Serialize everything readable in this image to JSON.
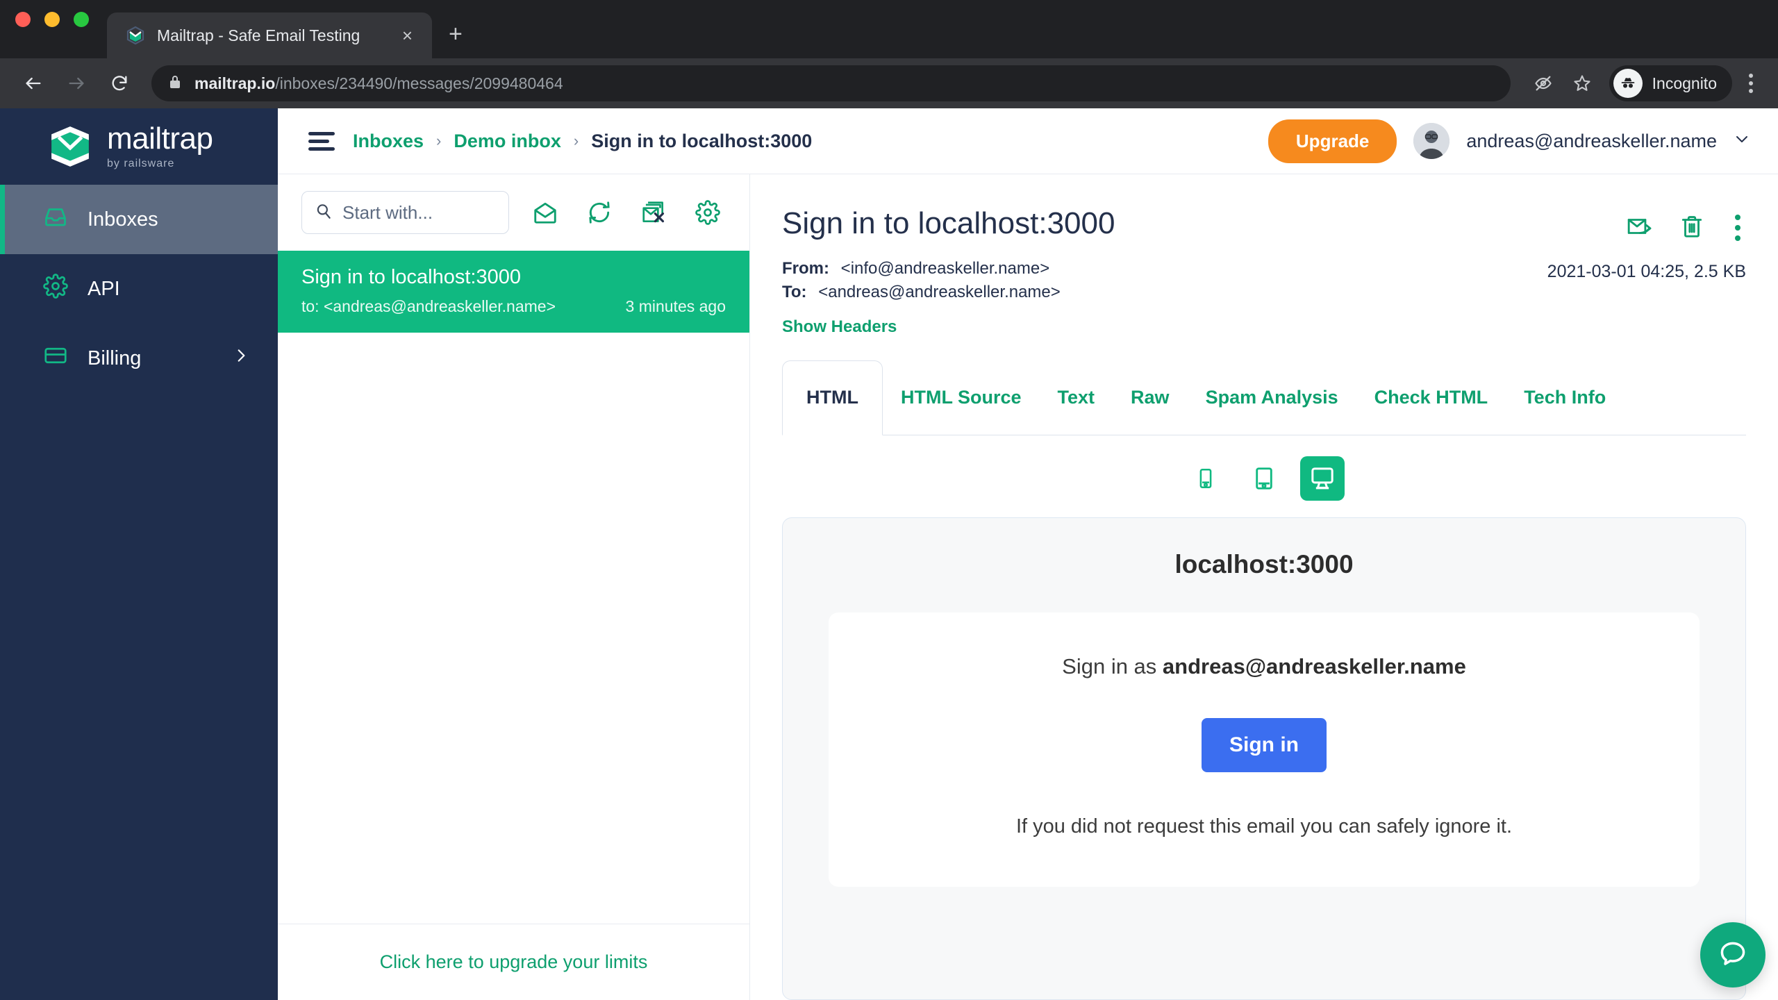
{
  "browser": {
    "tab": {
      "title": "Mailtrap - Safe Email Testing",
      "favicon_name": "mailtrap-favicon",
      "close_label": "×"
    },
    "new_tab_label": "+",
    "omnibox": {
      "host": "mailtrap.io",
      "path": "/inboxes/234490/messages/2099480464",
      "lock_icon": "lock-icon"
    },
    "profile": {
      "label": "Incognito"
    },
    "icons": {
      "back": "back-arrow-icon",
      "forward": "forward-arrow-icon",
      "reload": "reload-icon",
      "eye_off": "eye-off-icon",
      "star": "star-icon",
      "menu": "chrome-menu-icon"
    }
  },
  "sidebar": {
    "logo": {
      "word": "mailtrap",
      "sub": "by railsware"
    },
    "items": [
      {
        "label": "Inboxes",
        "icon": "inbox-icon",
        "active": true
      },
      {
        "label": "API",
        "icon": "gear-icon",
        "active": false
      },
      {
        "label": "Billing",
        "icon": "credit-card-icon",
        "active": false,
        "chevron": "›"
      }
    ]
  },
  "topbar": {
    "menu_icon": "hamburger-icon",
    "breadcrumb": [
      {
        "label": "Inboxes",
        "link": true
      },
      {
        "label": "Demo inbox",
        "link": true
      },
      {
        "label": "Sign in to localhost:3000",
        "link": false
      }
    ],
    "separator": "›",
    "upgrade_label": "Upgrade",
    "user_email": "andreas@andreaskeller.name",
    "chevron": "⌄"
  },
  "message_list": {
    "search": {
      "placeholder": "Start with...",
      "value": "",
      "icon": "search-icon"
    },
    "toolbar_icons": [
      {
        "name": "mark-as-read-icon"
      },
      {
        "name": "refresh-icon"
      },
      {
        "name": "delete-all-icon"
      },
      {
        "name": "settings-gear-icon"
      }
    ],
    "messages": [
      {
        "subject": "Sign in to localhost:3000",
        "to": "to: <andreas@andreaskeller.name>",
        "time": "3 minutes ago",
        "selected": true
      }
    ],
    "footer_link": "Click here to upgrade your limits"
  },
  "message_detail": {
    "title": "Sign in to localhost:3000",
    "from_label": "From:",
    "from_value": "<info@andreaskeller.name>",
    "to_label": "To:",
    "to_value": "<andreas@andreaskeller.name>",
    "show_headers": "Show Headers",
    "meta": "2021-03-01 04:25, 2.5 KB",
    "actions": [
      {
        "name": "forward-email-icon"
      },
      {
        "name": "delete-icon"
      },
      {
        "name": "more-options-icon"
      }
    ],
    "tabs": [
      {
        "label": "HTML",
        "active": true
      },
      {
        "label": "HTML Source",
        "active": false
      },
      {
        "label": "Text",
        "active": false
      },
      {
        "label": "Raw",
        "active": false
      },
      {
        "label": "Spam Analysis",
        "active": false
      },
      {
        "label": "Check HTML",
        "active": false
      },
      {
        "label": "Tech Info",
        "active": false
      }
    ],
    "device_toggles": [
      {
        "name": "mobile-preview-icon",
        "active": false
      },
      {
        "name": "tablet-preview-icon",
        "active": false
      },
      {
        "name": "desktop-preview-icon",
        "active": true
      }
    ],
    "preview": {
      "host_heading": "localhost:3000",
      "signin_prefix": "Sign in as ",
      "signin_email": "andreas@andreaskeller.name",
      "button_label": "Sign in",
      "note": "If you did not request this email you can safely ignore it."
    }
  },
  "support": {
    "beacon_icon": "chat-bubble-icon"
  },
  "colors": {
    "brand_teal": "#10b981",
    "brand_teal_text": "#0e9f6e",
    "sidebar_navy": "#1f2e4d",
    "upgrade_orange": "#f68a1e",
    "signin_blue": "#3b6ef0",
    "chrome_dark": "#202124"
  }
}
